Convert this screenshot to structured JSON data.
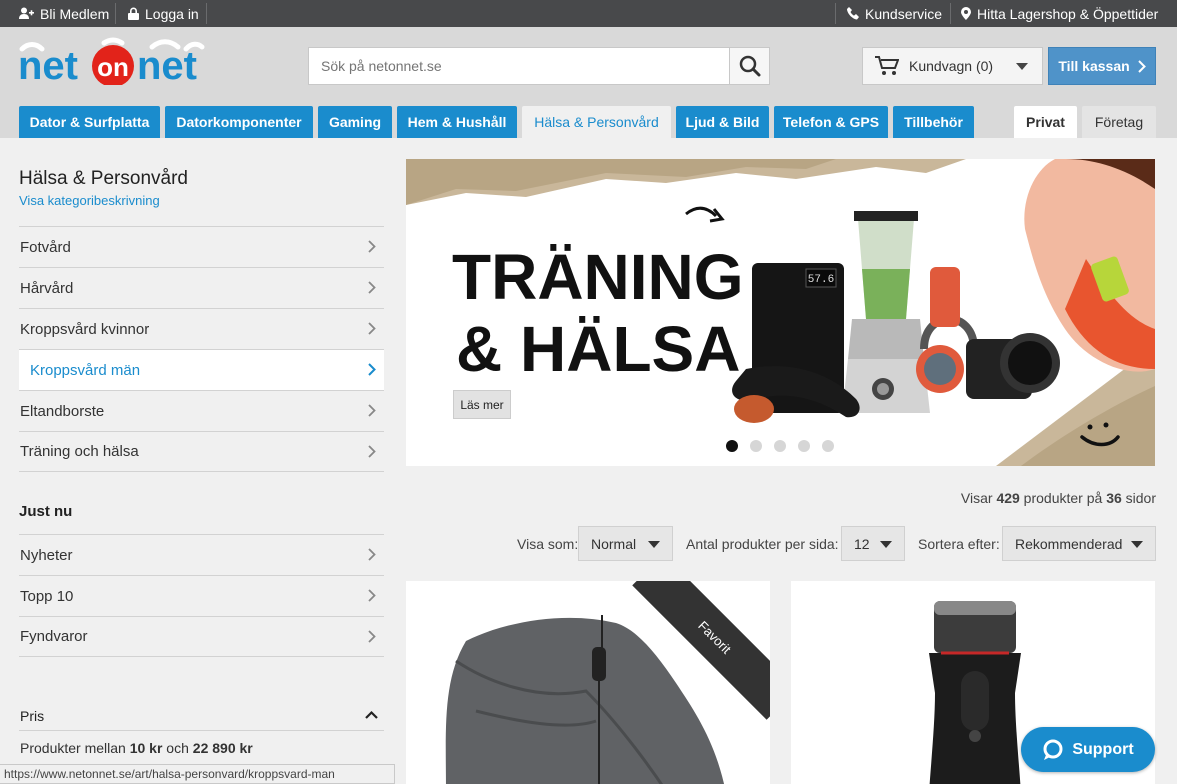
{
  "topbar": {
    "left": [
      {
        "label": "Bli Medlem",
        "icon": "add-user-icon"
      },
      {
        "label": "Logga in",
        "icon": "lock-icon"
      }
    ],
    "right": [
      {
        "label": "Kundservice",
        "icon": "phone-icon"
      },
      {
        "label": "Hitta Lagershop & Öppettider",
        "icon": "location-pin-icon"
      }
    ]
  },
  "header": {
    "logo": {
      "part1": "net",
      "part2": "on",
      "part3": "net"
    },
    "search_placeholder": "Sök på netonnet.se",
    "cart_label": "Kundvagn (0)",
    "checkout_label": "Till kassan"
  },
  "tabs": [
    {
      "label": "Dator & Surfplatta"
    },
    {
      "label": "Datorkomponenter"
    },
    {
      "label": "Gaming"
    },
    {
      "label": "Hem & Hushåll"
    },
    {
      "label": "Hälsa & Personvård",
      "active": true
    },
    {
      "label": "Ljud & Bild"
    },
    {
      "label": "Telefon & GPS"
    },
    {
      "label": "Tillbehör"
    }
  ],
  "segment_tabs": [
    {
      "label": "Privat",
      "active": true
    },
    {
      "label": "Företag"
    }
  ],
  "sidebar": {
    "title": "Hälsa & Personvård",
    "subtitle": "Visa kategoribeskrivning",
    "categories": [
      {
        "label": "Fotvård"
      },
      {
        "label": "Hårvård"
      },
      {
        "label": "Kroppsvård kvinnor"
      },
      {
        "label": "Kroppsvård män",
        "active": true
      },
      {
        "label": "Eltandborste"
      },
      {
        "label": "Träning och hälsa"
      }
    ],
    "just_nu_title": "Just nu",
    "just_nu": [
      {
        "label": "Nyheter"
      },
      {
        "label": "Topp 10"
      },
      {
        "label": "Fyndvaror"
      }
    ],
    "price_title": "Pris",
    "price_text_1": "Produkter mellan ",
    "price_min": "10 kr",
    "price_text_2": " och ",
    "price_max": "22 890 kr"
  },
  "banner": {
    "line1": "TRÄNING",
    "line2": "& HÄLSA",
    "button": "Läs mer",
    "scale_display": "57.6",
    "dots": 5,
    "active_dot": 1
  },
  "listing": {
    "info_prefix": "Visar ",
    "count": "429",
    "info_mid": " produkter på ",
    "pages": "36",
    "info_suffix": " sidor",
    "view_label": "Visa som:",
    "view_value": "Normal",
    "per_page_label": "Antal produkter per sida:",
    "per_page_value": "12",
    "sort_label": "Sortera efter:",
    "sort_value": "Rekommenderad"
  },
  "products": [
    {
      "ribbon": "Favorit",
      "image": "heated-blanket"
    },
    {
      "image": "electric-shaver"
    }
  ],
  "support_label": "Support",
  "status_url": "https://www.netonnet.se/art/halsa-personvard/kroppsvard-man",
  "colors": {
    "brand_blue": "#1a8ccd",
    "brand_red": "#e2231a",
    "topbar": "#48494b"
  }
}
